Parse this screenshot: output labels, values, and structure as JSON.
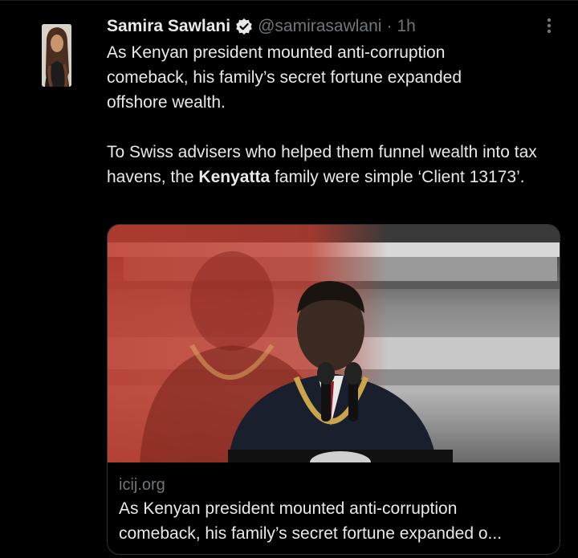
{
  "tweet": {
    "display_name": "Samira Sawlani",
    "verified": true,
    "handle": "@samirasawlani",
    "separator": "·",
    "time": "1h",
    "text_line1": "As Kenyan president mounted anti-corruption",
    "text_line2": "comeback, his family’s secret fortune expanded",
    "text_line3": "offshore wealth.",
    "text_para2_a": "To Swiss advisers who helped them funnel wealth into tax havens, the ",
    "text_para2_bold": "Kenyatta",
    "text_para2_b": " family were simple ‘Client 13173’."
  },
  "card": {
    "domain": "icij.org",
    "title_line1": "As Kenyan president mounted anti-corruption",
    "title_line2": "comeback, his family’s secret fortune expanded o..."
  },
  "icons": {
    "verified": "verified-badge-icon",
    "more": "more-vertical-icon"
  },
  "colors": {
    "background": "#000000",
    "primary_text": "#e7e9ea",
    "secondary_text": "#71767b",
    "card_border": "#2f3336",
    "image_red_tint": "#c0392b"
  }
}
